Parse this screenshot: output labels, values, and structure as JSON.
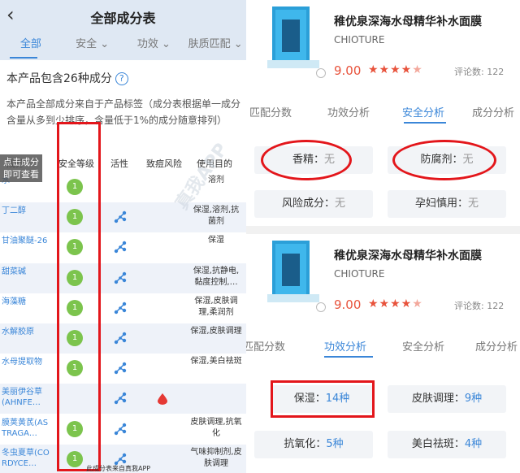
{
  "left": {
    "title": "全部成分表",
    "back_glyph": "‹",
    "tabs": [
      "全部",
      "安全",
      "功效",
      "肤质匹配"
    ],
    "tab_chevron": "⌄",
    "count_text": "本产品包含26种成分",
    "help_glyph": "?",
    "desc": "本产品全部成分来自于产品标签（成分表根据单一成分含量从多到少排序，含量低于1%的成分随意排列）",
    "overlay": [
      "点击成分",
      "即可查看"
    ],
    "headers": [
      "成分",
      "安全等级",
      "活性",
      "致痘风险",
      "使用目的"
    ],
    "rows": [
      {
        "name": "水",
        "safety": "1",
        "active": false,
        "acne": false,
        "use": "溶剂"
      },
      {
        "name": "丁二醇",
        "safety": "1",
        "active": true,
        "acne": false,
        "use": "保湿,溶剂,抗菌剂"
      },
      {
        "name": "甘油聚醚-26",
        "safety": "1",
        "active": true,
        "acne": false,
        "use": "保湿"
      },
      {
        "name": "甜菜碱",
        "safety": "1",
        "active": true,
        "acne": false,
        "use": "保湿,抗静电,黏度控制,…"
      },
      {
        "name": "海藻糖",
        "safety": "1",
        "active": true,
        "acne": false,
        "use": "保湿,皮肤调理,柔润剂"
      },
      {
        "name": "水解胶原",
        "safety": "1",
        "active": true,
        "acne": false,
        "use": "保湿,皮肤调理"
      },
      {
        "name": "水母提取物",
        "safety": "1",
        "active": true,
        "acne": false,
        "use": "保湿,美白祛斑"
      },
      {
        "name": "美丽伊谷草(AHNFE…",
        "safety": "",
        "active": true,
        "acne": true,
        "use": ""
      },
      {
        "name": "膜荚黄芪(ASTRAGA…",
        "safety": "1",
        "active": true,
        "acne": false,
        "use": "皮肤调理,抗氧化"
      },
      {
        "name": "冬虫夏草(CORDYCE…",
        "safety": "1",
        "active": true,
        "acne": false,
        "use": "气味抑制剂,皮肤调理"
      }
    ],
    "footer": "此成分表来自真我APP",
    "watermark": "真我APP"
  },
  "right": {
    "product_name": "稚优泉深海水母精华补水面膜",
    "brand": "CHIOTURE",
    "price": "9.00",
    "stars": "★★★★",
    "half_star": "★",
    "reviews": "评论数: 122",
    "tabs_top": [
      "匹配分数",
      "功效分析",
      "安全分析",
      "成分分析"
    ],
    "safety_cards": [
      {
        "label": "香精：",
        "value": "无"
      },
      {
        "label": "防腐剂：",
        "value": "无"
      },
      {
        "label": "风险成分：",
        "value": "无"
      },
      {
        "label": "孕妇慎用：",
        "value": "无"
      }
    ],
    "tabs_bottom": [
      "匹配分数",
      "功效分析",
      "安全分析",
      "成分分析"
    ],
    "effect_cards": [
      {
        "label": "保湿：",
        "value": "14种"
      },
      {
        "label": "皮肤调理：",
        "value": "9种"
      },
      {
        "label": "抗氧化：",
        "value": "5种"
      },
      {
        "label": "美白祛斑：",
        "value": "4种"
      }
    ]
  },
  "colors": {
    "accent": "#3a86d8",
    "highlight": "#e3161b",
    "safe": "#7cc44d",
    "price": "#e8533c"
  }
}
